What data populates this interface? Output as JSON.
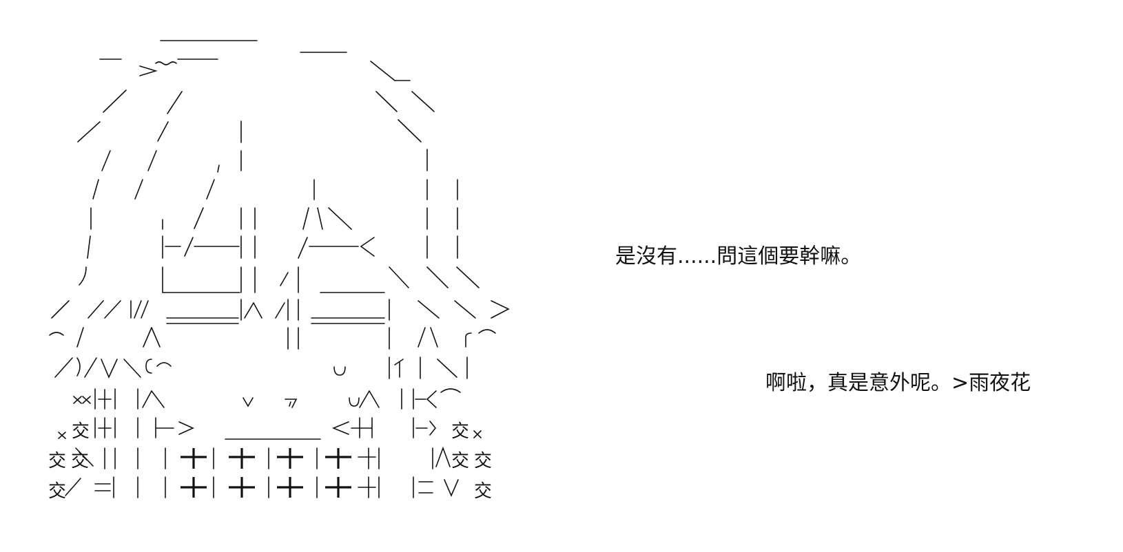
{
  "ascii_art": {
    "description_icon": "ascii-art-girl-face-icon",
    "row_1": "＿＿＿＿　　＿＿",
    "row_2": "─､>‐･-─",
    "row_glyphs": [
      "u",
      "v",
      "ア",
      "u人",
      "交",
      "×",
      "＜",
      "＞",
      "八",
      "人",
      "二",
      "V",
      "r⌒",
      "⌒"
    ]
  },
  "dialogue": {
    "line_1": "是沒有......問這個要幹嘛。",
    "line_2": "啊啦，真是意外呢。>雨夜花"
  },
  "colors": {
    "background": "#ffffff",
    "ink": "#111111"
  }
}
